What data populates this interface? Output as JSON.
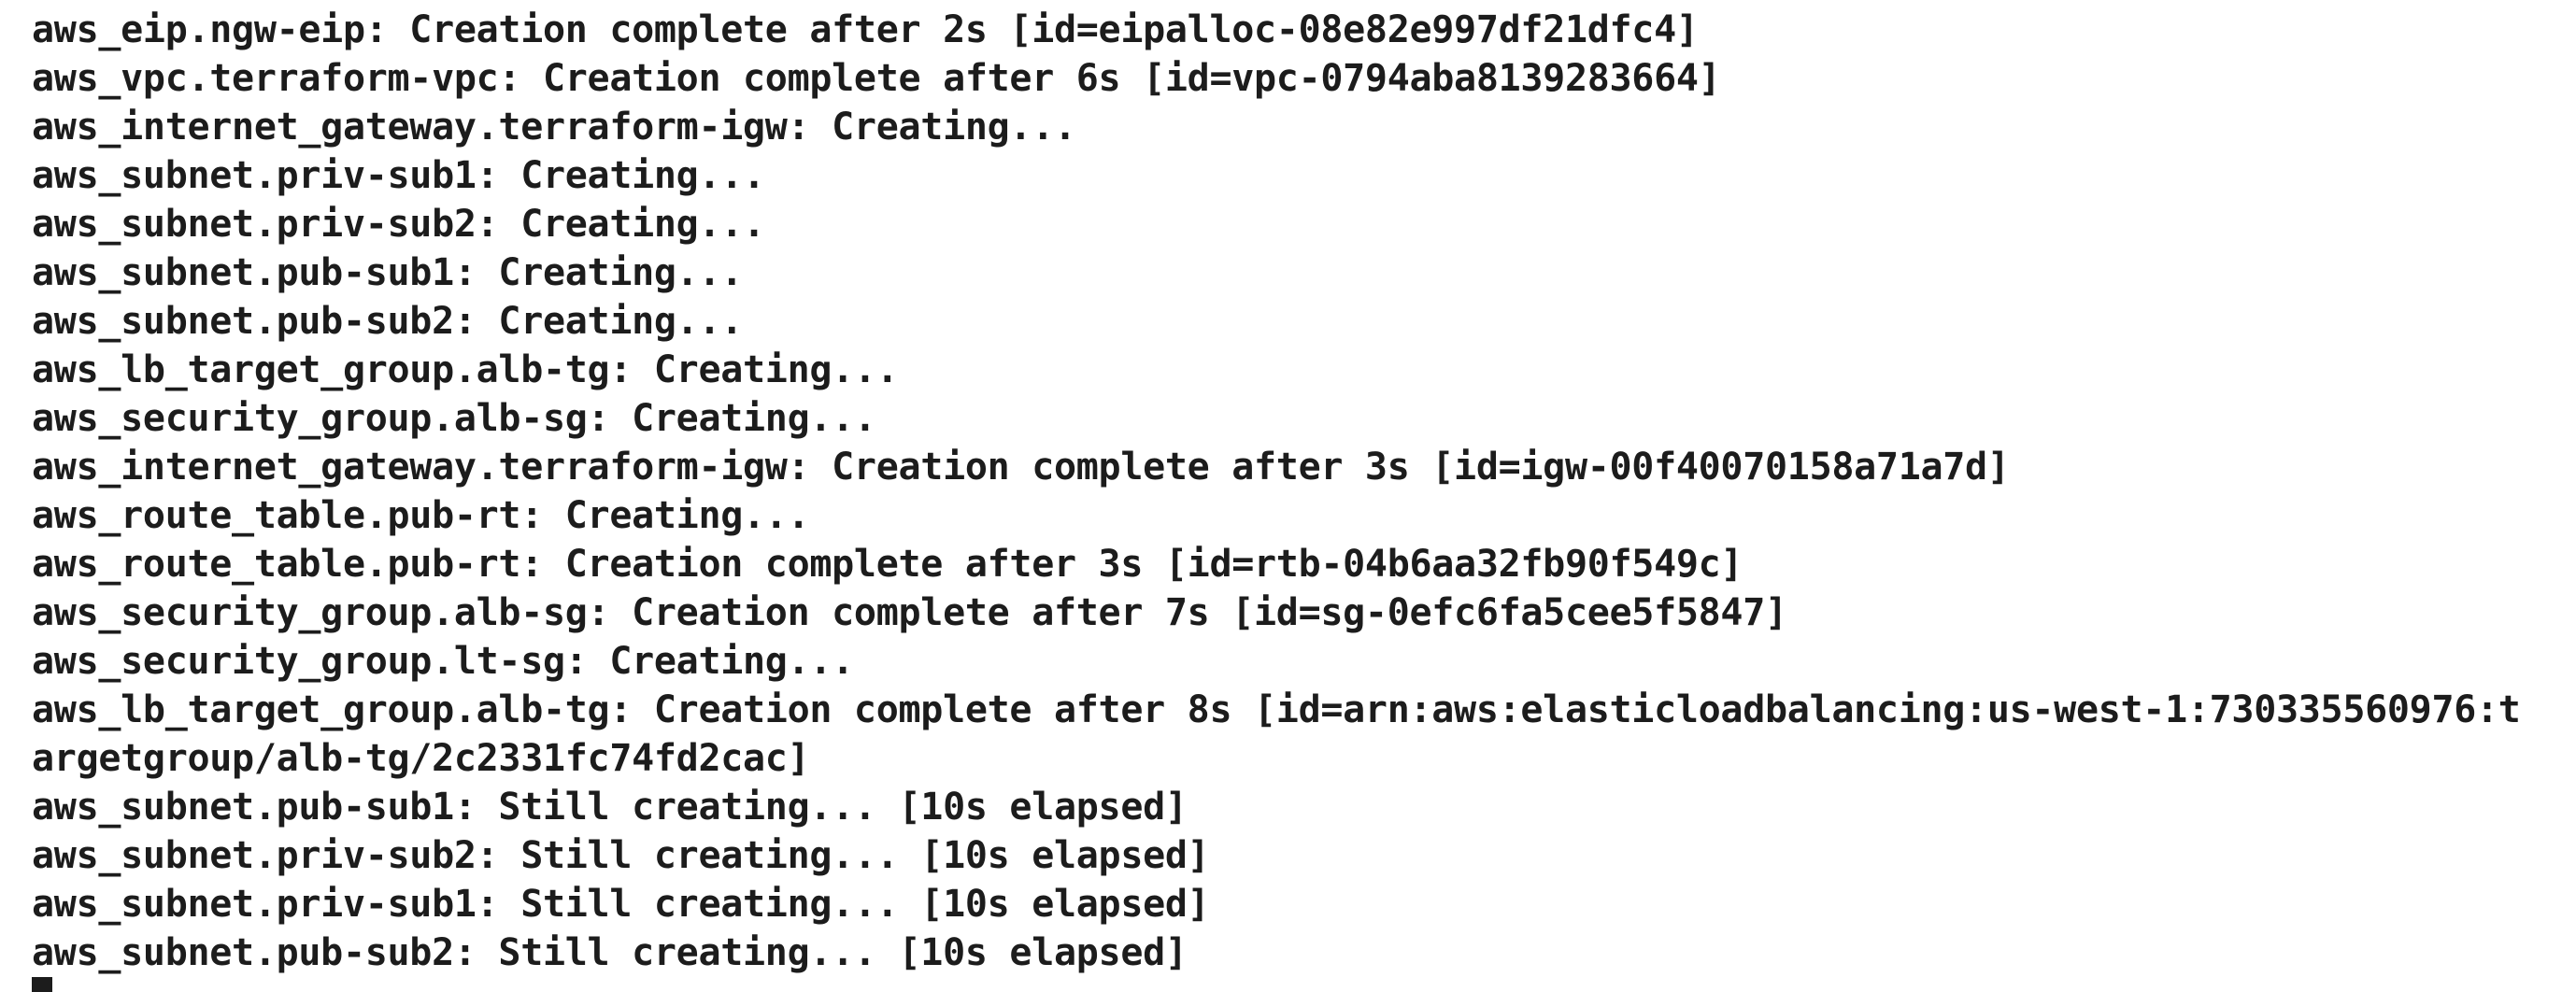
{
  "terminal": {
    "lines": [
      "aws_eip.ngw-eip: Creation complete after 2s [id=eipalloc-08e82e997df21dfc4]",
      "aws_vpc.terraform-vpc: Creation complete after 6s [id=vpc-0794aba8139283664]",
      "aws_internet_gateway.terraform-igw: Creating...",
      "aws_subnet.priv-sub1: Creating...",
      "aws_subnet.priv-sub2: Creating...",
      "aws_subnet.pub-sub1: Creating...",
      "aws_subnet.pub-sub2: Creating...",
      "aws_lb_target_group.alb-tg: Creating...",
      "aws_security_group.alb-sg: Creating...",
      "aws_internet_gateway.terraform-igw: Creation complete after 3s [id=igw-00f40070158a71a7d]",
      "aws_route_table.pub-rt: Creating...",
      "aws_route_table.pub-rt: Creation complete after 3s [id=rtb-04b6aa32fb90f549c]",
      "aws_security_group.alb-sg: Creation complete after 7s [id=sg-0efc6fa5cee5f5847]",
      "aws_security_group.lt-sg: Creating...",
      "aws_lb_target_group.alb-tg: Creation complete after 8s [id=arn:aws:elasticloadbalancing:us-west-1:730335560976:t",
      "argetgroup/alb-tg/2c2331fc74fd2cac]",
      "aws_subnet.pub-sub1: Still creating... [10s elapsed]",
      "aws_subnet.priv-sub2: Still creating... [10s elapsed]",
      "aws_subnet.priv-sub1: Still creating... [10s elapsed]",
      "aws_subnet.pub-sub2: Still creating... [10s elapsed]"
    ]
  }
}
